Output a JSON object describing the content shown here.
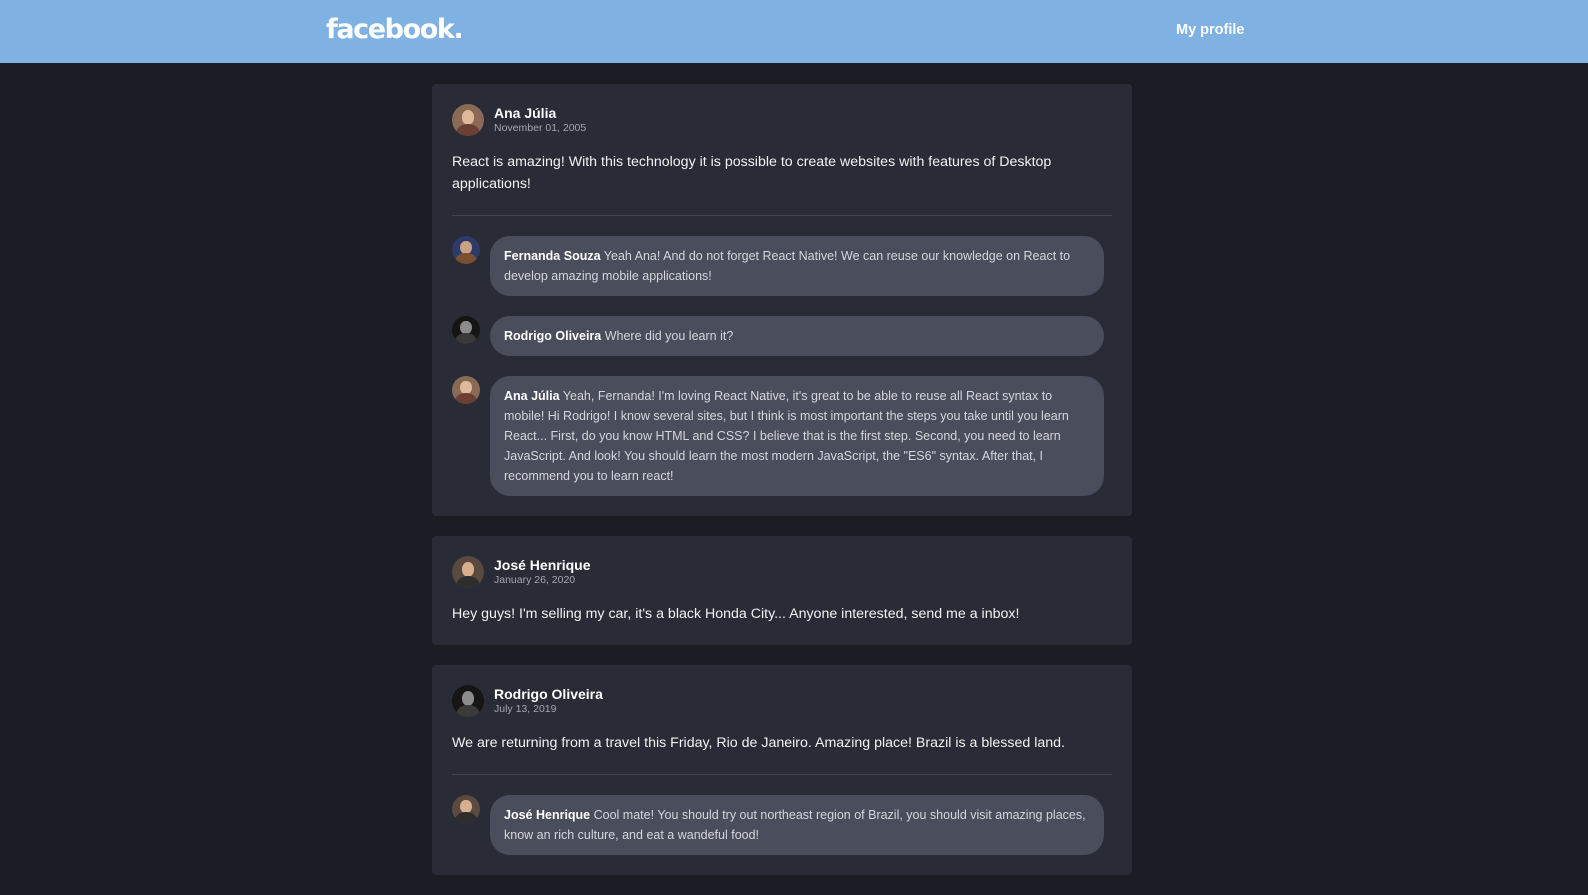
{
  "header": {
    "logo": "facebook.",
    "profile_link": "My profile",
    "background": "#7fb2e3"
  },
  "posts": [
    {
      "author": "Ana Júlia",
      "date": "November 01, 2005",
      "content": "React is amazing! With this technology it is possible to create websites with features of Desktop applications!",
      "comments": [
        {
          "author": "Fernanda Souza",
          "text": "Yeah Ana! And do not forget React Native! We can reuse our knowledge on React to develop amazing mobile applications!"
        },
        {
          "author": "Rodrigo Oliveira",
          "text": "Where did you learn it?"
        },
        {
          "author": "Ana Júlia",
          "text": "Yeah, Fernanda! I'm loving React Native, it's great to be able to reuse all React syntax to mobile! Hi Rodrigo! I know several sites, but I think is most important the steps you take until you learn React... First, do you know HTML and CSS? I believe that is the first step. Second, you need to learn JavaScript. And look! You should learn the most modern JavaScript, the \"ES6\" syntax. After that, I recommend you to learn react!"
        }
      ]
    },
    {
      "author": "José Henrique",
      "date": "January 26, 2020",
      "content": "Hey guys! I'm selling my car, it's a black Honda City... Anyone interested, send me a inbox!",
      "comments": []
    },
    {
      "author": "Rodrigo Oliveira",
      "date": "July 13, 2019",
      "content": "We are returning from a travel this Friday, Rio de Janeiro. Amazing place! Brazil is a blessed land.",
      "comments": [
        {
          "author": "José Henrique",
          "text": "Cool mate! You should try out northeast region of Brazil, you should visit amazing places, know an rich culture, and eat a wandeful food!"
        }
      ]
    }
  ]
}
